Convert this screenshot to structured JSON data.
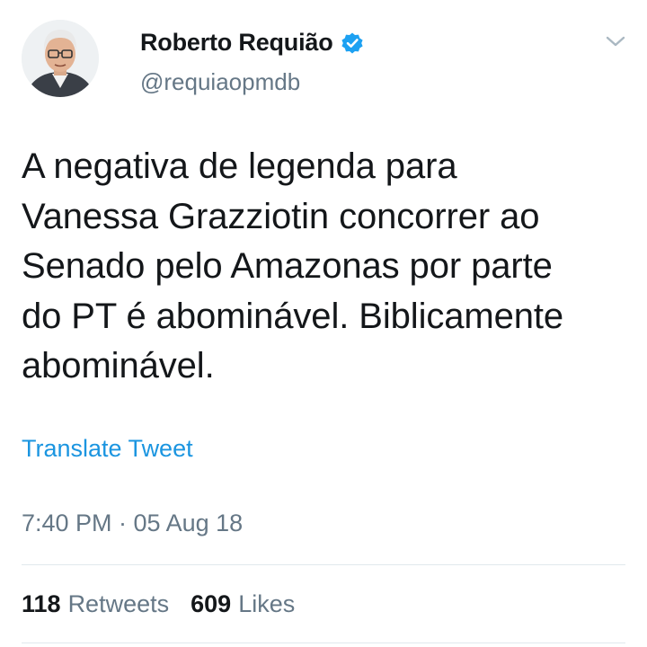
{
  "author": {
    "name": "Roberto Requião",
    "handle": "@requiaopmdb",
    "verified": true
  },
  "tweet": {
    "text": "A negativa de legenda para\nVanessa Grazziotin concorrer ao\nSenado pelo Amazonas por parte\ndo PT é abominável. Biblicamente\nabominável.",
    "translate_label": "Translate Tweet",
    "timestamp": "7:40 PM · 05 Aug 18"
  },
  "stats": {
    "retweets_count": "118",
    "retweets_label": "Retweets",
    "likes_count": "609",
    "likes_label": "Likes"
  },
  "icons": {
    "verified": "verified-badge-icon",
    "menu": "chevron-down-icon"
  },
  "colors": {
    "link": "#1b95e0",
    "secondary_text": "#657786",
    "primary_text": "#14171a",
    "verified": "#1da1f2",
    "divider": "#e1e8ed"
  }
}
